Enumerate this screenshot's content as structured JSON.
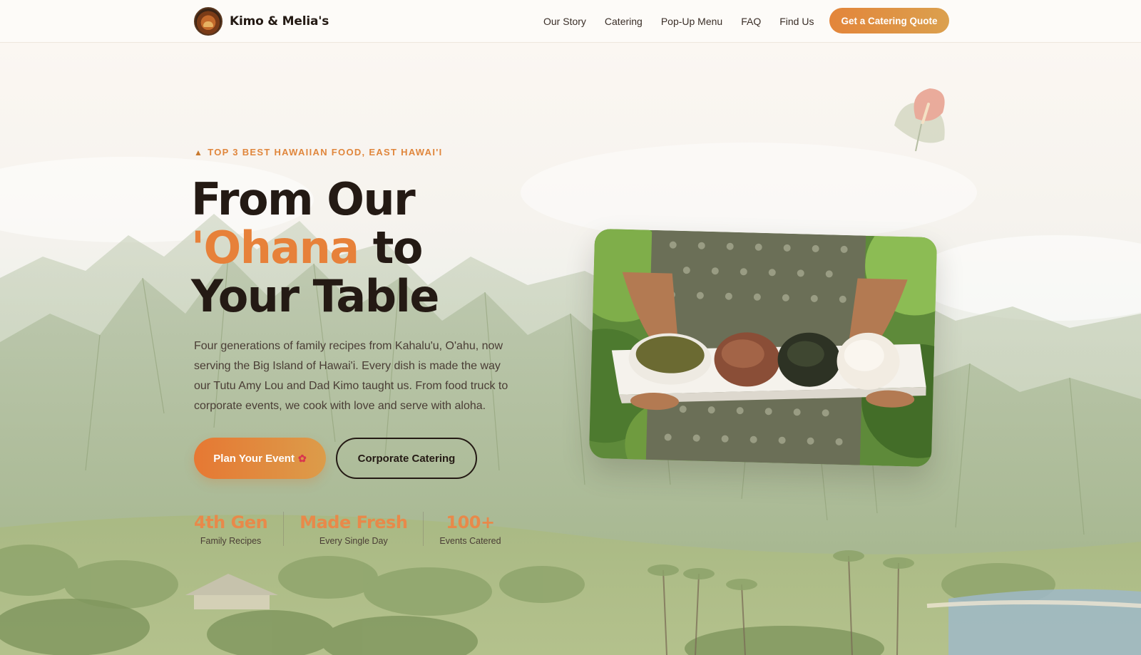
{
  "brand": {
    "name": "Kimo & Melia's",
    "logo_icon": "restaurant-logo"
  },
  "nav": {
    "links": [
      "Our Story",
      "Catering",
      "Pop-Up Menu",
      "FAQ",
      "Find Us"
    ],
    "cta_label": "Get a Catering Quote"
  },
  "hero": {
    "eyebrow_icon": "trophy-icon",
    "eyebrow": "TOP 3 BEST HAWAIIAN FOOD, EAST HAWAI'I",
    "headline": {
      "line1": "From Our",
      "accent": "'Ohana",
      "line2_rest": " to",
      "line3": "Your Table"
    },
    "lede": "Four generations of family recipes from Kahalu'u, O'ahu, now serving the Big Island of Hawai'i. Every dish is made the way our Tutu Amy Lou and Dad Kimo taught us. From food truck to corporate events, we cook with love and serve with aloha.",
    "primary_button": "Plan Your Event",
    "primary_button_icon": "hibiscus-icon",
    "secondary_button": "Corporate Catering",
    "stats": [
      {
        "value": "4th Gen",
        "label": "Family Recipes"
      },
      {
        "value": "Made Fresh",
        "label": "Every Single Day"
      },
      {
        "value": "100+",
        "label": "Events Catered"
      }
    ]
  },
  "colors": {
    "accent": "#e7813a",
    "ink": "#241a14",
    "background": "#fbf9f5"
  }
}
